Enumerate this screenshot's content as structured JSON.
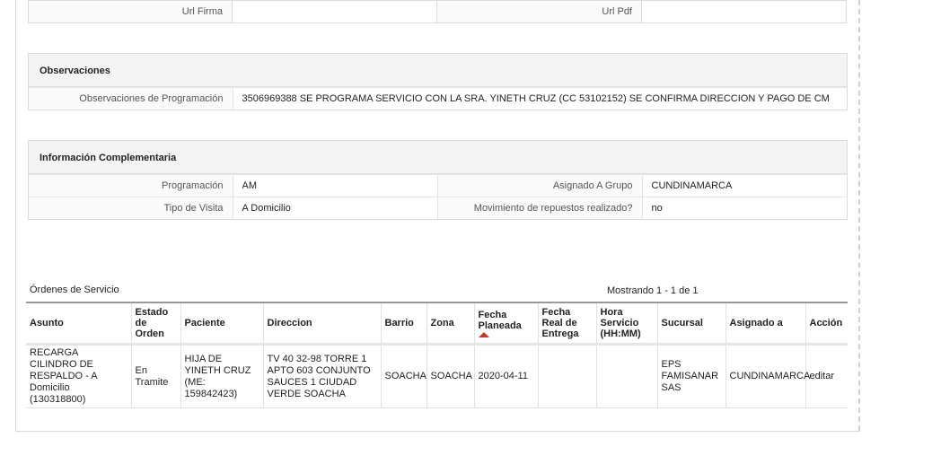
{
  "urls": {
    "firma_label": "Url Firma",
    "firma_value": "",
    "pdf_label": "Url Pdf",
    "pdf_value": ""
  },
  "observaciones": {
    "title": "Observaciones",
    "label": "Observaciones de Programación",
    "value": "3506969388 SE PROGRAMA SERVICIO CON LA SRA. YINETH CRUZ (CC 53102152) SE CONFIRMA DIRECCION Y PAGO DE CM"
  },
  "complementaria": {
    "title": "Información Complementaria",
    "programacion_label": "Programación",
    "programacion_value": "AM",
    "grupo_label": "Asignado A Grupo",
    "grupo_value": "CUNDINAMARCA",
    "tipo_label": "Tipo de Visita",
    "tipo_value": "A Domicilio",
    "repuestos_label": "Movimiento de repuestos realizado?",
    "repuestos_value": "no"
  },
  "orders": {
    "title": "Órdenes de Servicio",
    "showing": "Mostrando 1 - 1 de 1",
    "headers": {
      "asunto": "Asunto",
      "estado": "Estado de Orden",
      "paciente": "Paciente",
      "direccion": "Direccion",
      "barrio": "Barrio",
      "zona": "Zona",
      "fecha_planeada": "Fecha Planeada",
      "fecha_real": "Fecha Real de Entrega",
      "hora": "Hora Servicio (HH:MM)",
      "sucursal": "Sucursal",
      "asignado": "Asignado a",
      "accion": "Acción"
    },
    "rows": [
      {
        "asunto": "RECARGA CILINDRO DE RESPALDO - A Domicilio (130318800)",
        "estado": "En Tramite",
        "paciente": "HIJA DE YINETH CRUZ (ME: 159842423)",
        "direccion": "TV 40 32-98 TORRE 1 APTO 603 CONJUNTO SAUCES 1 CIUDAD VERDE SOACHA",
        "barrio": "SOACHA",
        "zona": "SOACHA",
        "fecha_planeada": "2020-04-11",
        "fecha_real": "",
        "hora": "",
        "sucursal": "EPS FAMISANAR SAS",
        "asignado": "CUNDINAMARCA",
        "accion": "editar"
      }
    ]
  }
}
